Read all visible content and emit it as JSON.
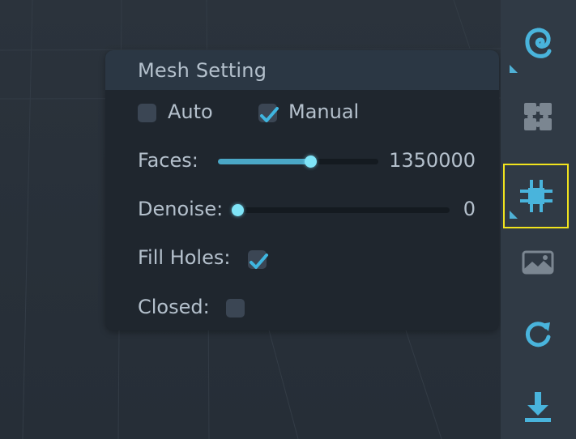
{
  "colors": {
    "accent": "#4aa7c6",
    "thumb": "#7fe4f7",
    "check": "#3fb6e0",
    "active_outline": "#f1e31d",
    "panel_bg": "#1f262e",
    "panel_header": "#2b3744",
    "toolbar_bg": "#303a45"
  },
  "panel": {
    "title": "Mesh Setting",
    "mode": {
      "auto": {
        "label": "Auto",
        "checked": false
      },
      "manual": {
        "label": "Manual",
        "checked": true
      }
    },
    "faces": {
      "label": "Faces:",
      "value": "1350000",
      "fraction": 0.58
    },
    "denoise": {
      "label": "Denoise:",
      "value": "0",
      "fraction": 0.0
    },
    "fill_holes": {
      "label": "Fill Holes:",
      "checked": true
    },
    "closed": {
      "label": "Closed:",
      "checked": false
    }
  },
  "toolbar": {
    "items": [
      {
        "icon": "logo-swirl-icon",
        "active": false
      },
      {
        "icon": "puzzle-icon",
        "active": false
      },
      {
        "icon": "mesh-grid-icon",
        "active": true
      },
      {
        "icon": "image-landscape-icon",
        "active": false
      },
      {
        "icon": "refresh-icon",
        "active": false
      },
      {
        "icon": "download-icon",
        "active": false
      }
    ]
  }
}
